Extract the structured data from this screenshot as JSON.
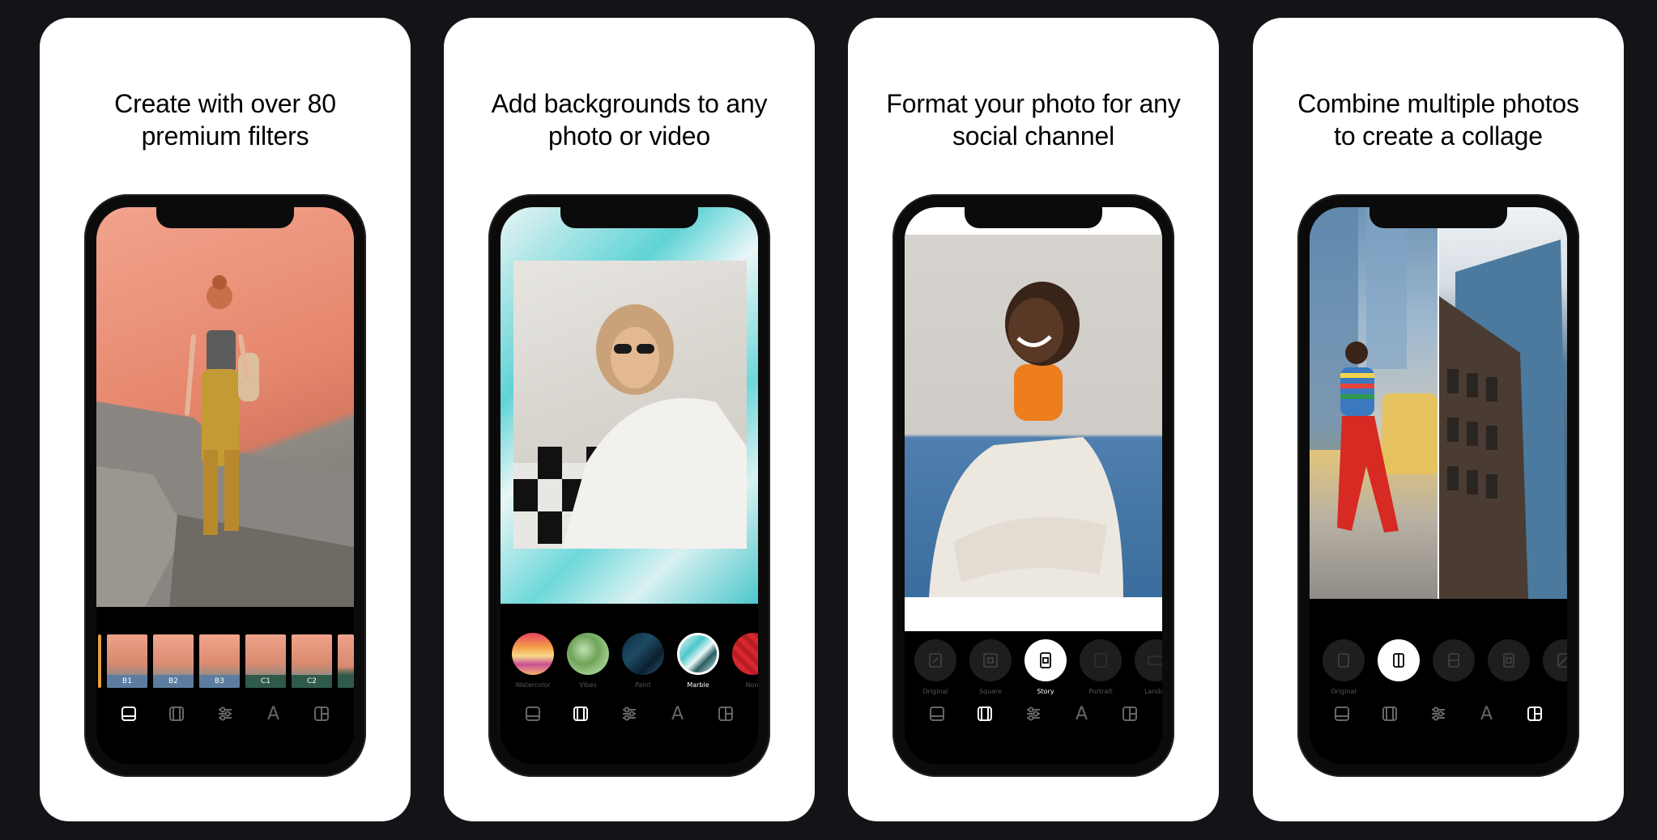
{
  "cards": [
    {
      "title_line1": "Create with over 80",
      "title_line2": "premium filters"
    },
    {
      "title_line1": "Add backgrounds to any",
      "title_line2": "photo or video"
    },
    {
      "title_line1": "Format your photo for any",
      "title_line2": "social channel"
    },
    {
      "title_line1": "Combine multiple photos",
      "title_line2": "to create a collage"
    }
  ],
  "filters": {
    "labels": [
      "B1",
      "B2",
      "B3",
      "C1",
      "C2"
    ]
  },
  "backgrounds": {
    "options": [
      "Watercolor",
      "Vibes",
      "Paint",
      "Marble",
      "Nord"
    ],
    "selected": "Marble"
  },
  "formats": {
    "options": [
      "Original",
      "Square",
      "Story",
      "Portrait",
      "Landsc"
    ],
    "selected": "Story"
  },
  "collage": {
    "options": [
      "Original",
      "",
      "",
      "",
      ""
    ],
    "selected_index": 1
  },
  "tabbar": {
    "icons": [
      "layout-icon",
      "frame-icon",
      "adjust-icon",
      "text-icon",
      "collage-icon"
    ],
    "text_tab_glyph": "A"
  },
  "colors": {
    "background": "#131418",
    "card": "#ffffff",
    "phone": "#0b0b0b",
    "active_icon": "#ffffff",
    "inactive_icon": "#666666"
  }
}
